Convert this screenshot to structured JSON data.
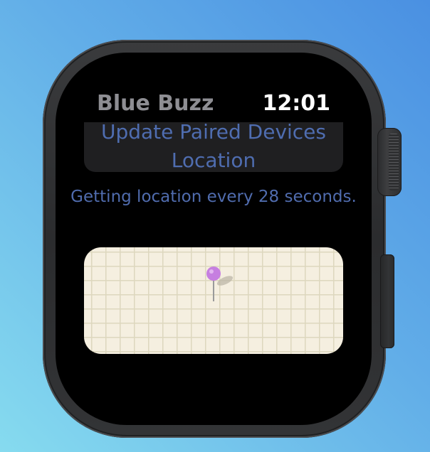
{
  "header": {
    "app_title": "Blue Buzz",
    "time": "12:01"
  },
  "actions": {
    "update_button_label": "Update Paired Devices Location"
  },
  "status": {
    "message": "Getting location every 28 seconds."
  },
  "map": {
    "pin_icon": "map-pin-icon",
    "pin_color": "#c67fe0"
  },
  "colors": {
    "accent_text": "#4f6db0",
    "background_gradient": [
      "#4a90e2",
      "#86dbef"
    ]
  }
}
